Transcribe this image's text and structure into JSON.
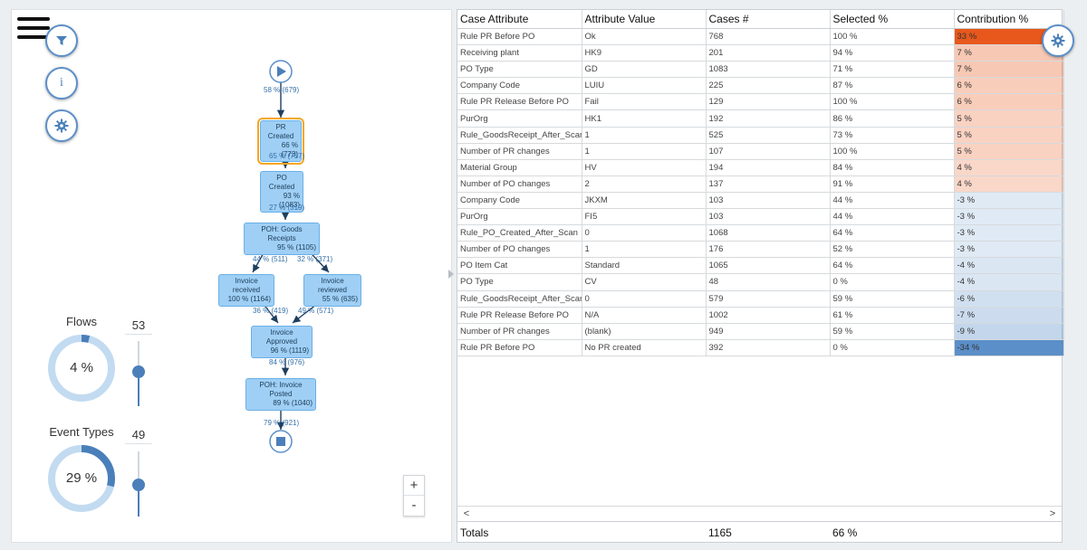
{
  "flows": {
    "title": "Flows",
    "donut_label": "4 %",
    "donut_fraction": 0.04,
    "slider_value": "53",
    "slider_level": 0.53
  },
  "event_types": {
    "title": "Event Types",
    "donut_label": "29 %",
    "donut_fraction": 0.29,
    "slider_value": "49",
    "slider_level": 0.49
  },
  "zoom": {
    "in_label": "+",
    "out_label": "-"
  },
  "process_map": {
    "start_edge": "58 % (679)",
    "nodes": [
      {
        "name": "PR Created",
        "stat": "66 % (773)"
      },
      {
        "name": "PO Created",
        "stat": "93 % (1083)"
      },
      {
        "name": "POH: Goods Receipts",
        "stat": "95 % (1105)"
      },
      {
        "name": "Invoice received",
        "stat": "100 % (1164)"
      },
      {
        "name": "Invoice reviewed",
        "stat": "55 % (635)"
      },
      {
        "name": "Invoice Approved",
        "stat": "96 % (1119)"
      },
      {
        "name": "POH: Invoice Posted",
        "stat": "89 % (1040)"
      }
    ],
    "edges": [
      "65 % (757)",
      "27 % (319)",
      "44 % (511)",
      "32 % (371)",
      "36 % (419)",
      "49 % (571)",
      "84 % (976)",
      "79 % (921)"
    ]
  },
  "table": {
    "headers": [
      "Case Attribute",
      "Attribute Value",
      "Cases #",
      "Selected %",
      "Contribution %"
    ],
    "rows": [
      [
        "Rule PR Before PO",
        "Ok",
        "768",
        "100 %",
        "33 %"
      ],
      [
        "Receiving plant",
        "HK9",
        "201",
        "94 %",
        "7 %"
      ],
      [
        "PO Type",
        "GD",
        "1083",
        "71 %",
        "7 %"
      ],
      [
        "Company Code",
        "LUIU",
        "225",
        "87 %",
        "6 %"
      ],
      [
        "Rule PR Release Before PO",
        "Fail",
        "129",
        "100 %",
        "6 %"
      ],
      [
        "PurOrg",
        "HK1",
        "192",
        "86 %",
        "5 %"
      ],
      [
        "Rule_GoodsReceipt_After_Scan",
        "1",
        "525",
        "73 %",
        "5 %"
      ],
      [
        "Number of PR changes",
        "1",
        "107",
        "100 %",
        "5 %"
      ],
      [
        "Material Group",
        "HV",
        "194",
        "84 %",
        "4 %"
      ],
      [
        "Number of PO changes",
        "2",
        "137",
        "91 %",
        "4 %"
      ],
      [
        "Company Code",
        "JKXM",
        "103",
        "44 %",
        "-3 %"
      ],
      [
        "PurOrg",
        "FI5",
        "103",
        "44 %",
        "-3 %"
      ],
      [
        "Rule_PO_Created_After_Scan",
        "0",
        "1068",
        "64 %",
        "-3 %"
      ],
      [
        "Number of PO changes",
        "1",
        "176",
        "52 %",
        "-3 %"
      ],
      [
        "PO Item Cat",
        "Standard",
        "1065",
        "64 %",
        "-4 %"
      ],
      [
        "PO Type",
        "CV",
        "48",
        "0 %",
        "-4 %"
      ],
      [
        "Rule_GoodsReceipt_After_Scan",
        "0",
        "579",
        "59 %",
        "-6 %"
      ],
      [
        "Rule PR Release Before PO",
        "N/A",
        "1002",
        "61 %",
        "-7 %"
      ],
      [
        "Number of PR changes",
        "(blank)",
        "949",
        "59 %",
        "-9 %"
      ],
      [
        "Rule PR Before PO",
        "No PR created",
        "392",
        "0 %",
        "-34 %"
      ]
    ],
    "contribution_values": [
      33,
      7,
      7,
      6,
      6,
      5,
      5,
      5,
      4,
      4,
      -3,
      -3,
      -3,
      -3,
      -4,
      -4,
      -6,
      -7,
      -9,
      -34
    ],
    "totals": {
      "label": "Totals",
      "cases": "1165",
      "selected": "66 %"
    },
    "scroll_left": "<",
    "scroll_right": ">"
  },
  "colors": {
    "accent": "#4a7fba",
    "positive": "#e8581c",
    "negative": "#5b8fc9",
    "node_fill": "#9fcff5",
    "selected_outline": "#f5a623"
  },
  "icons": {
    "menu": "hamburger-icon",
    "filter": "filter-icon",
    "info": "info-icon",
    "settings": "gear-icon",
    "start": "play-icon",
    "end": "stop-icon"
  }
}
